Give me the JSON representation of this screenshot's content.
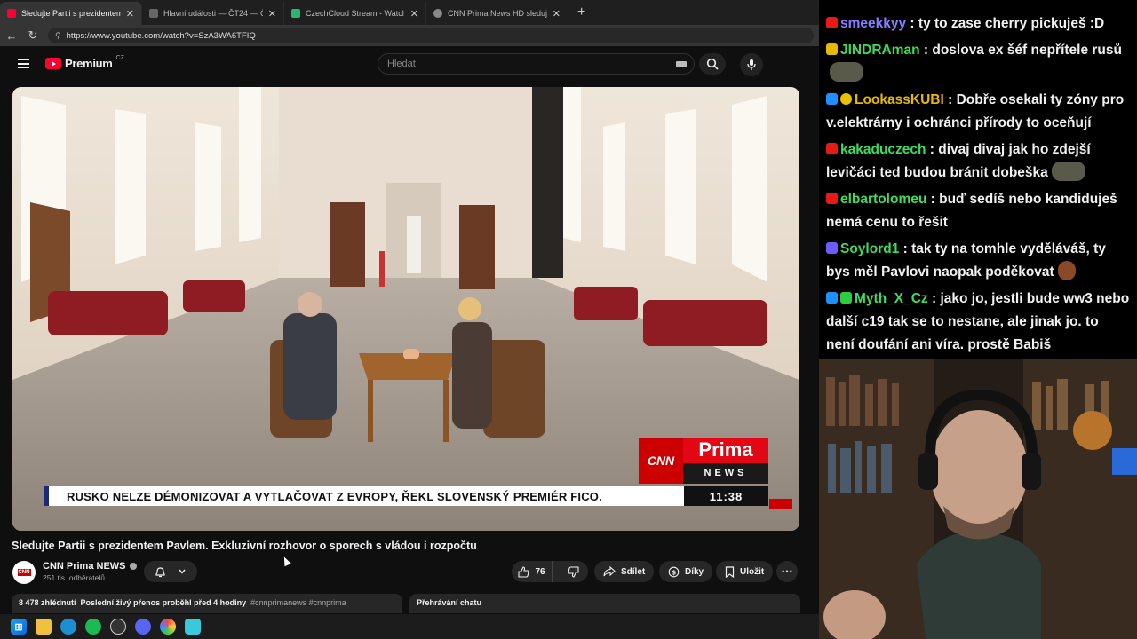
{
  "browser": {
    "tabs": [
      {
        "title": "Sledujte Partii s prezidentem Pavle",
        "color": "#ff0033",
        "active": true
      },
      {
        "title": "Hlavní události — ČT24 — Česká",
        "color": "#666666",
        "active": false
      },
      {
        "title": "CzechCloud Stream - Watch Live",
        "color": "#2bb673",
        "active": false
      },
      {
        "title": "CNN Prima News HD sledujte onl",
        "color": "#888888",
        "active": false
      }
    ],
    "new_tab": "+",
    "url": "https://www.youtube.com/watch?v=SzA3WA6TFIQ"
  },
  "youtube": {
    "logo_text": "Premium",
    "logo_country": "CZ",
    "search_placeholder": "Hledat"
  },
  "video": {
    "ticker": "RUSKO NELZE DÉMONIZOVAT A VYTLAČOVAT Z EVROPY, ŘEKL SLOVENSKÝ PREMIÉR FICO.",
    "clock": "11:38",
    "cnn": "CNN",
    "prima": "Prima",
    "news": "NEWS"
  },
  "meta": {
    "title": "Sledujte Partii s prezidentem Pavlem. Exkluzivní rozhovor o sporech s vládou i rozpočtu",
    "channel": "CNN Prima NEWS",
    "subscribers": "251 tis. odběratelů",
    "likes": "76",
    "share": "Sdílet",
    "thanks": "Díky",
    "save": "Uložit",
    "views": "8 478 zhlédnutí",
    "live_note": "Poslední živý přenos proběhl před 4 hodiny",
    "tags": "#cnnprimanews #cnnprima",
    "chat_replay": "Přehrávání chatu"
  },
  "chat": [
    {
      "user": "smeekkyy",
      "color": "#8a7dff",
      "badges": [
        "#e91916"
      ],
      "text": "ty to zase cherry pickuješ :D"
    },
    {
      "user": "JINDRAman",
      "color": "#3ddc5c",
      "badges": [
        "#e6b800"
      ],
      "text": "doslova ex šéf nepřítele rusů",
      "emote": "#5a5a4a"
    },
    {
      "user": "LookassKUBI",
      "color": "#e6b800",
      "badges": [
        "#1e90ff",
        "#e6c200"
      ],
      "text": "Dobře osekali ty zóny pro v.elektrárny i ochránci přírody to oceňují"
    },
    {
      "user": "kakaduczech",
      "color": "#3ddc5c",
      "badges": [
        "#e91916"
      ],
      "text": "divaj divaj jak ho zdejší levičáci ted budou bránit dobeška",
      "emote": "#5a5a4a"
    },
    {
      "user": "elbartolomeu",
      "color": "#3ddc5c",
      "badges": [
        "#e91916"
      ],
      "text": "buď sedíš nebo kandiduješ nemá cenu to řešit"
    },
    {
      "user": "Soylord1",
      "color": "#3ddc5c",
      "badges": [
        "#6a5cff"
      ],
      "text": "tak ty na tomhle vyděláváš, ty bys měl Pavlovi naopak poděkovat",
      "emote": "#8a4a2a"
    },
    {
      "user": "Myth_X_Cz",
      "color": "#3ddc5c",
      "badges": [
        "#1e90ff",
        "#2ecc40"
      ],
      "text": "jako jo, jestli bude ww3 nebo další c19 tak se to nestane, ale jinak jo. to není doufání ani víra. prostě Babiš"
    }
  ]
}
